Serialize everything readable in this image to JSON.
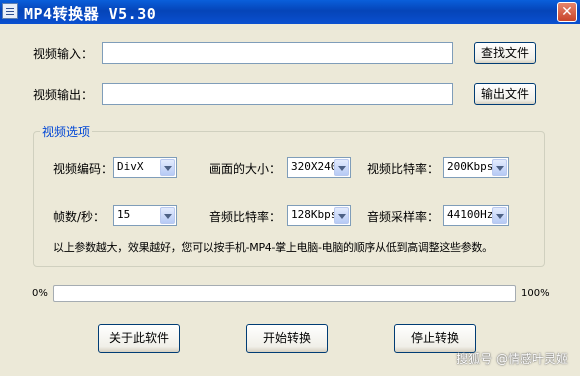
{
  "window": {
    "title": "MP4转换器 V5.30",
    "close_glyph": "✕"
  },
  "io": {
    "input_label": "视频输入：",
    "input_value": "",
    "browse_button": "查找文件",
    "output_label": "视频输出：",
    "output_value": "",
    "output_button": "输出文件"
  },
  "options": {
    "group_title": "视频选项",
    "codec_label": "视频编码：",
    "codec_value": "DivX",
    "size_label": "画面的大小：",
    "size_value": "320X240",
    "vbitrate_label": "视频比特率：",
    "vbitrate_value": "200Kbps",
    "fps_label": "帧数/秒：",
    "fps_value": "15",
    "abitrate_label": "音频比特率：",
    "abitrate_value": "128Kbps",
    "samplerate_label": "音频采样率：",
    "samplerate_value": "44100Hz",
    "hint": "以上参数越大，效果越好，您可以按手机-MP4-掌上电脑-电脑的顺序从低到高调整这些参数。"
  },
  "progress": {
    "min_label": "0%",
    "max_label": "100%",
    "value_percent": 0,
    "fill_color": "#2FB52F"
  },
  "buttons": {
    "about": "关于此软件",
    "start": "开始转换",
    "stop": "停止转换"
  },
  "watermark": "搜狐号 @情感叶灵姬",
  "icons": {
    "app": "app-window-icon",
    "close": "close-icon",
    "dropdown": "chevron-down-icon"
  },
  "colors": {
    "titlebar": "#0A5FDB",
    "window_bg": "#ECE9D8",
    "group_title": "#0046D5",
    "close_button": "#C8442A"
  }
}
